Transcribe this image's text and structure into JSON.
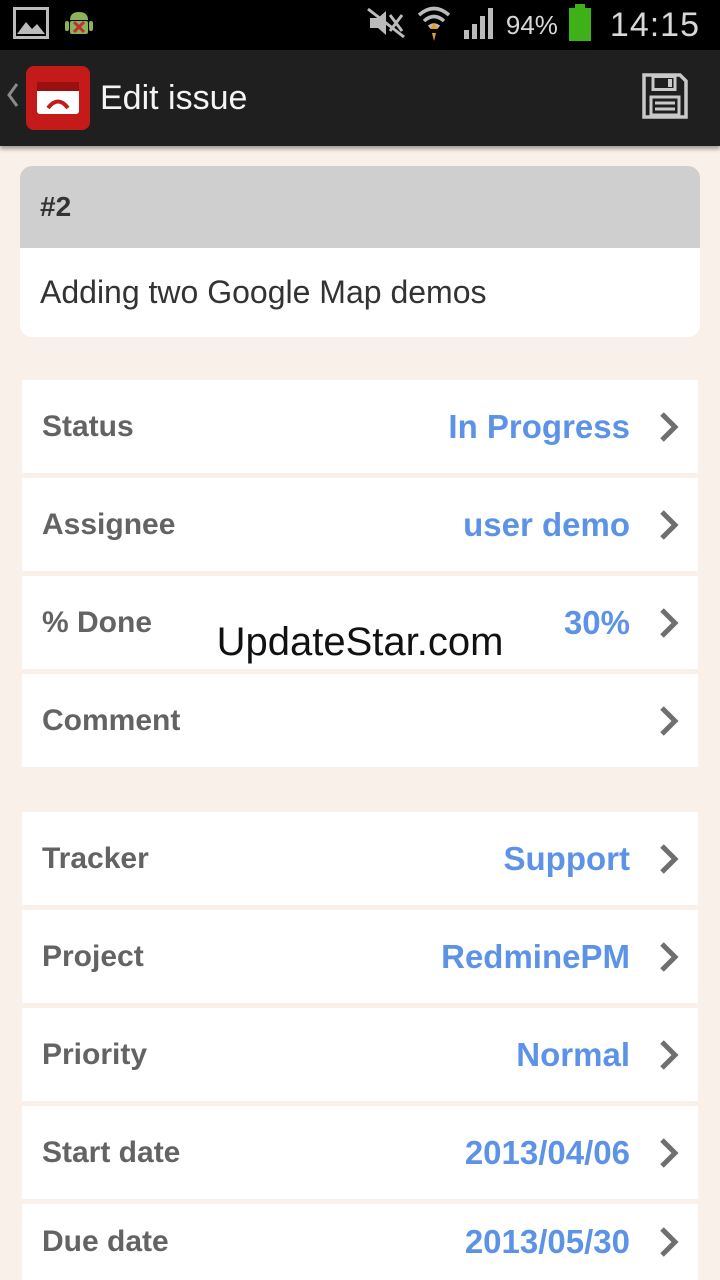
{
  "status_bar": {
    "battery_percent": "94%",
    "time": "14:15",
    "icons": [
      "image-icon",
      "android-debug-icon",
      "mute-icon",
      "wifi-icon",
      "signal-icon",
      "battery-icon"
    ]
  },
  "action_bar": {
    "title": "Edit issue",
    "icons": [
      "back-chevron-icon",
      "redmine-app-icon",
      "save-icon"
    ]
  },
  "issue": {
    "id": "#2",
    "subject": "Adding two Google Map demos"
  },
  "group1": [
    {
      "label": "Status",
      "value": "In Progress"
    },
    {
      "label": "Assignee",
      "value": "user demo"
    },
    {
      "label": "% Done",
      "value": "30%"
    },
    {
      "label": "Comment",
      "value": ""
    }
  ],
  "group2": [
    {
      "label": "Tracker",
      "value": "Support"
    },
    {
      "label": "Project",
      "value": "RedminePM"
    },
    {
      "label": "Priority",
      "value": "Normal"
    },
    {
      "label": "Start date",
      "value": "2013/04/06"
    },
    {
      "label": "Due date",
      "value": "2013/05/30"
    }
  ],
  "watermark": "UpdateStar.com",
  "colors": {
    "accent": "#5d93e6",
    "label": "#636363",
    "background": "#faf0ea",
    "app_icon": "#c41a1a",
    "action_bar": "#1f1f1f"
  }
}
